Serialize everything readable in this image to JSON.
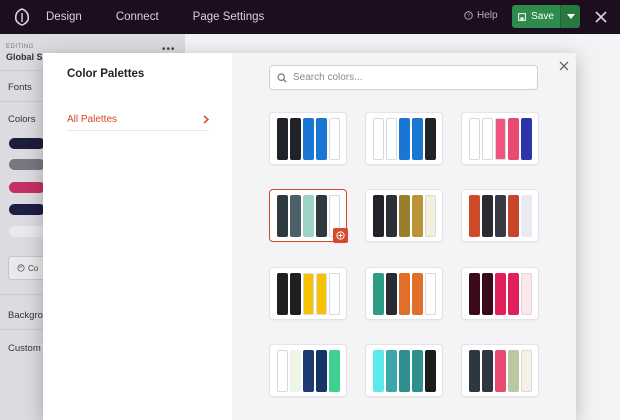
{
  "topbar": {
    "nav": [
      "Design",
      "Connect",
      "Page Settings"
    ],
    "help_label": "Help",
    "save_label": "Save"
  },
  "left_panel": {
    "editing_label": "EDITING",
    "title": "Global S",
    "sections": {
      "fonts": "Fonts",
      "colors": "Colors",
      "background": "Backgro",
      "custom": "Custom"
    },
    "color_button_label": "Co",
    "swatches": [
      "#1d1d3c",
      "#77777f",
      "#c43063",
      "#1d1d45",
      "#e9e9ec"
    ]
  },
  "modal": {
    "title": "Color Palettes",
    "side_link": "All Palettes",
    "search_placeholder": "Search colors...",
    "palettes": [
      {
        "colors": [
          "#1f2226",
          "#1f2226",
          "#1976d2",
          "#1976d2",
          "#ffffff"
        ]
      },
      {
        "colors": [
          "#ffffff",
          "#ffffff",
          "#1976d2",
          "#1976d2",
          "#1f2226"
        ]
      },
      {
        "colors": [
          "#ffffff",
          "#ffffff",
          "#f0557f",
          "#e94a72",
          "#2c35a8"
        ]
      },
      {
        "colors": [
          "#2c3a40",
          "#4c6166",
          "#9ed2c6",
          "#2c3a40",
          "#ffffff"
        ],
        "selected": true
      },
      {
        "colors": [
          "#23232a",
          "#2e2e38",
          "#9a7e2e",
          "#b89436",
          "#f4f0dc"
        ]
      },
      {
        "colors": [
          "#ce4a28",
          "#2a2a34",
          "#3a3a44",
          "#c9452a",
          "#eaeaf2"
        ]
      },
      {
        "colors": [
          "#1f1f22",
          "#1f1f22",
          "#f5c300",
          "#f5c300",
          "#ffffff"
        ]
      },
      {
        "colors": [
          "#2f9c85",
          "#2a2a34",
          "#e07029",
          "#e07029",
          "#ffffff"
        ]
      },
      {
        "colors": [
          "#3a0a1a",
          "#3a0a1a",
          "#e0205a",
          "#e0205a",
          "#fde6ec"
        ]
      },
      {
        "colors": [
          "#ffffff",
          "#eef5e8",
          "#1f3b73",
          "#153566",
          "#3fcf8e"
        ]
      },
      {
        "colors": [
          "#5de9ea",
          "#3aa8a8",
          "#2f8f8f",
          "#2f8f8f",
          "#1b1b1b"
        ]
      },
      {
        "colors": [
          "#2e3640",
          "#2e3640",
          "#e94a72",
          "#b9c7a3",
          "#f5f2e4"
        ]
      }
    ]
  }
}
